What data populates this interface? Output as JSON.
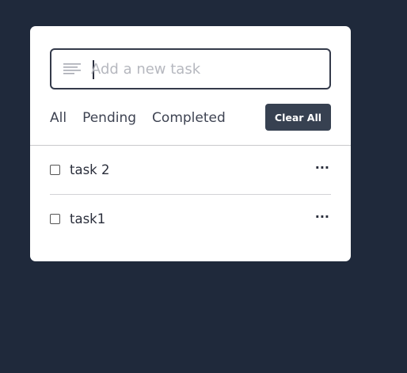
{
  "colors": {
    "background": "#1f293b",
    "card": "#ffffff",
    "accent_button": "#374151"
  },
  "input": {
    "placeholder": "Add a new task",
    "value": "",
    "icon": "lines-icon"
  },
  "filters": [
    {
      "label": "All"
    },
    {
      "label": "Pending"
    },
    {
      "label": "Completed"
    }
  ],
  "clear_label": "Clear All",
  "tasks": [
    {
      "label": "task 2",
      "checked": false,
      "menu_icon": "ellipsis-icon"
    },
    {
      "label": "task1",
      "checked": false,
      "menu_icon": "ellipsis-icon"
    }
  ]
}
